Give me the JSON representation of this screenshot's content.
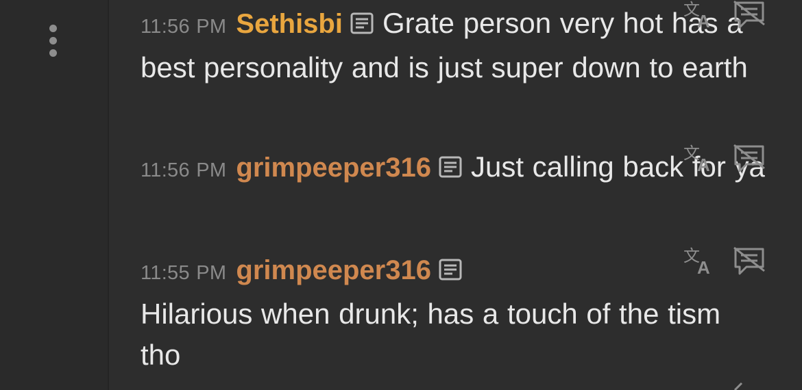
{
  "messages": [
    {
      "time": "11:56 PM",
      "username": "Sethisbi",
      "text": "Grate person very hot has a best personality and is just super down to earth",
      "username_color": "#e9a63f"
    },
    {
      "time": "11:56 PM",
      "username": "grimpeeper316",
      "text": "Just calling back for ya",
      "username_color": "#d0884f"
    },
    {
      "time": "11:55 PM",
      "username": "grimpeeper316",
      "text": "Hilarious when drunk; has a touch of the tism tho",
      "username_color": "#d0884f"
    }
  ],
  "icons": {
    "menu": "kebab-menu-icon",
    "note": "note-icon",
    "translate": "translate-icon",
    "hide": "hide-message-icon"
  },
  "colors": {
    "background": "#2d2d2d",
    "timestamp": "#8a8a8a",
    "message_text": "#e8e8e8"
  }
}
